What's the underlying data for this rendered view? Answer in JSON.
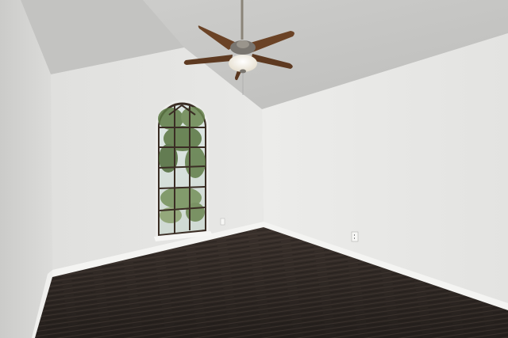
{
  "scene": {
    "subject": "empty-room",
    "features": [
      "vaulted-ceiling",
      "ceiling-fan",
      "arched-window",
      "dark-wood-floor",
      "white-baseboards",
      "wall-outlets"
    ]
  },
  "colors": {
    "ceiling": "#c9c9c7",
    "left_wall": "#d5d5d3",
    "back_wall": "#e4e4e2",
    "right_wall": "#e9e9e7",
    "floor_dark": "#2b2522",
    "floor_light": "#4a403a",
    "baseboard": "#f4f4f2",
    "fan_blade": "#6b4326",
    "fan_metal": "#7a7670",
    "fan_light": "#f3efe4",
    "window_frame": "#3a2d24",
    "foliage": "#5d7a45",
    "sky": "#dfe8e6"
  }
}
